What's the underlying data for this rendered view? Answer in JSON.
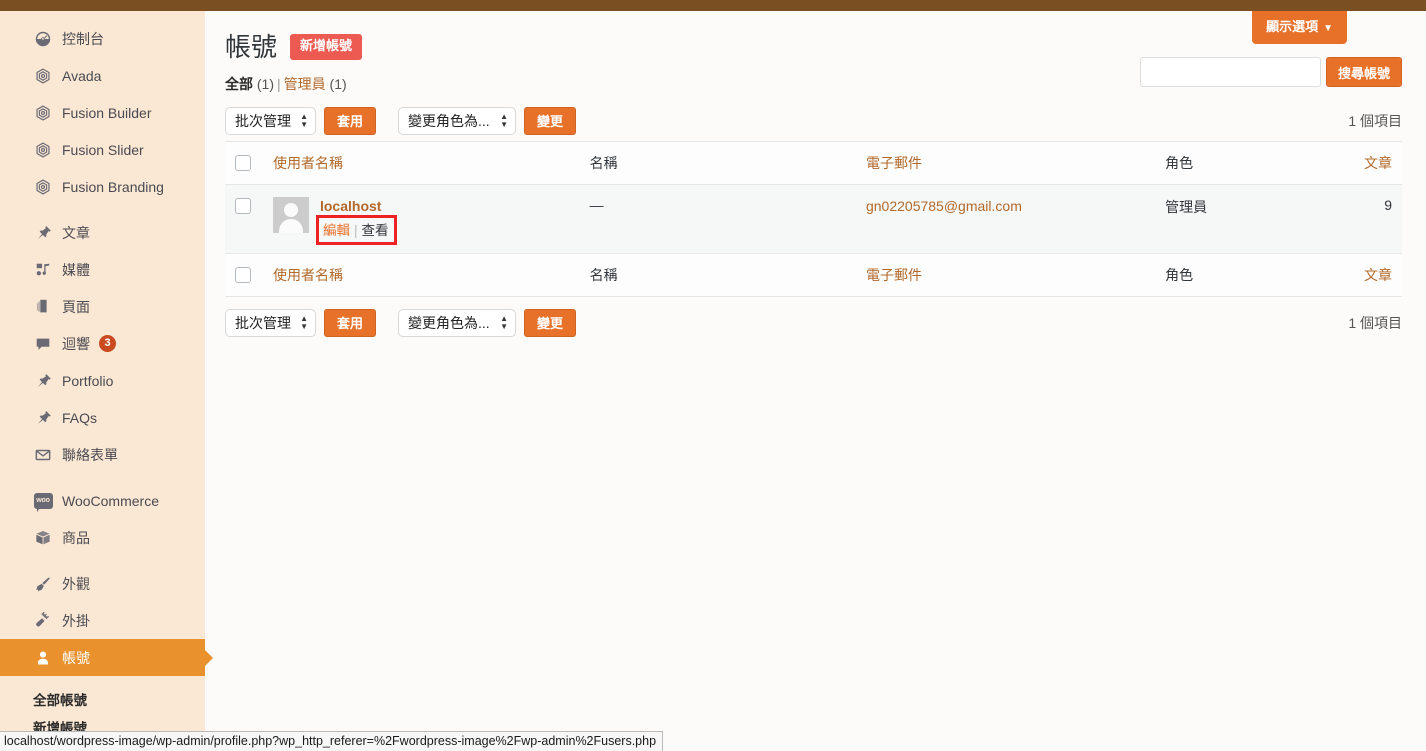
{
  "adminbar": {
    "color": "#7a5023"
  },
  "theme": {
    "sidebar_bg": "#fbe8d4",
    "accent_orange": "#e8712a",
    "current_menu_bg": "#e8912d",
    "add_new_red": "#ed5a51",
    "link_brown": "#b2692b",
    "row_bg": "#f6f7f7",
    "annotation_red": "#ee2222"
  },
  "sidebar": {
    "groups": [
      {
        "items": [
          {
            "label": "控制台",
            "icon": "dashboard-icon",
            "name": "sidebar-item-dashboard"
          },
          {
            "label": "Avada",
            "icon": "avada-hex-icon",
            "name": "sidebar-item-avada"
          },
          {
            "label": "Fusion Builder",
            "icon": "avada-hex-icon",
            "name": "sidebar-item-fusion-builder"
          },
          {
            "label": "Fusion Slider",
            "icon": "avada-hex-icon",
            "name": "sidebar-item-fusion-slider"
          },
          {
            "label": "Fusion Branding",
            "icon": "avada-hex-icon",
            "name": "sidebar-item-fusion-branding"
          }
        ]
      },
      {
        "items": [
          {
            "label": "文章",
            "icon": "pin-icon",
            "name": "sidebar-item-posts"
          },
          {
            "label": "媒體",
            "icon": "media-icon",
            "name": "sidebar-item-media"
          },
          {
            "label": "頁面",
            "icon": "pages-icon",
            "name": "sidebar-item-pages"
          },
          {
            "label": "迴響",
            "icon": "comment-icon",
            "name": "sidebar-item-comments",
            "badge": "3"
          },
          {
            "label": "Portfolio",
            "icon": "pin-icon",
            "name": "sidebar-item-portfolio"
          },
          {
            "label": "FAQs",
            "icon": "pin-icon",
            "name": "sidebar-item-faqs"
          },
          {
            "label": "聯絡表單",
            "icon": "envelope-icon",
            "name": "sidebar-item-contact-form"
          }
        ]
      },
      {
        "items": [
          {
            "label": "WooCommerce",
            "icon": "woo-icon",
            "name": "sidebar-item-woocommerce"
          },
          {
            "label": "商品",
            "icon": "box-icon",
            "name": "sidebar-item-products"
          }
        ]
      },
      {
        "items": [
          {
            "label": "外觀",
            "icon": "brush-icon",
            "name": "sidebar-item-appearance"
          },
          {
            "label": "外掛",
            "icon": "plugin-icon",
            "name": "sidebar-item-plugins"
          },
          {
            "label": "帳號",
            "icon": "user-icon",
            "name": "sidebar-item-users",
            "current": true
          }
        ]
      }
    ],
    "submenu": [
      {
        "label": "全部帳號",
        "name": "submenu-item-all-users",
        "current": true
      },
      {
        "label": "新增帳號",
        "name": "submenu-item-add-new-user",
        "current": false
      }
    ]
  },
  "showopts": {
    "label": "顯示選項",
    "caret": "▼"
  },
  "header": {
    "title": "帳號",
    "add_new_label": "新增帳號"
  },
  "views": {
    "all_label": "全部",
    "all_count": "(1)",
    "divider": "|",
    "admin_label": "管理員",
    "admin_count": "(1)"
  },
  "search": {
    "value": "",
    "placeholder": "",
    "submit_label": "搜尋帳號"
  },
  "tablenav_top": {
    "bulk_select": "批次管理",
    "apply_label": "套用",
    "role_select": "變更角色為...",
    "change_label": "變更",
    "displaying_num": "1 個項目"
  },
  "tablenav_bottom": {
    "bulk_select": "批次管理",
    "apply_label": "套用",
    "role_select": "變更角色為...",
    "change_label": "變更",
    "displaying_num": "1 個項目"
  },
  "table": {
    "columns": {
      "user": "使用者名稱",
      "name": "名稱",
      "email": "電子郵件",
      "role": "角色",
      "posts": "文章"
    },
    "rows": [
      {
        "username": "localhost",
        "name": "—",
        "email": "gn02205785@gmail.com",
        "role": "管理員",
        "posts": "9",
        "actions": {
          "edit": "編輯",
          "separator": "|",
          "view": "查看"
        }
      }
    ]
  },
  "statusbar": {
    "url": "localhost/wordpress-image/wp-admin/profile.php?wp_http_referer=%2Fwordpress-image%2Fwp-admin%2Fusers.php"
  }
}
